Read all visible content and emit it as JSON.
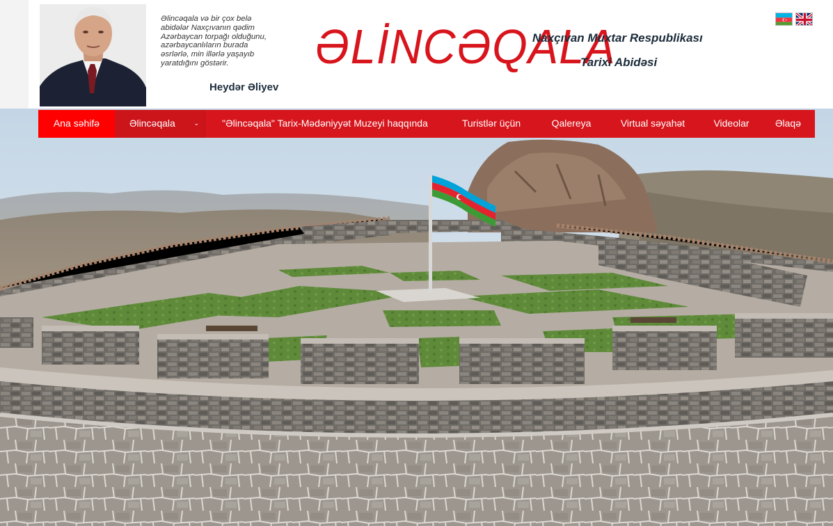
{
  "header": {
    "quote_lines": [
      "Əlincəqala və bir çox belə",
      "abidələr Naxçıvanın qədim",
      "Azərbaycan torpağı olduğunu,",
      "azərbaycanlıların burada",
      "əsrlərlə, min illərlə yaşayıb",
      "yaratdığını göstərir."
    ],
    "quote_author": "Heydər Əliyev",
    "logo": "ƏLİNCƏQALA",
    "subtitle_line1": "Naxçıvan Muxtar Respublikası",
    "subtitle_line2": "Tarixi Abidəsi"
  },
  "languages": [
    "az-flag-icon",
    "uk-flag-icon"
  ],
  "nav": {
    "items": [
      {
        "label": "Ana səhifə"
      },
      {
        "label": "Əlincəqala"
      },
      {
        "label": "\"Əlincəqala\" Tarix-Mədəniyyət Muzeyi haqqında"
      },
      {
        "label": "Turistlər üçün"
      },
      {
        "label": "Qalereya"
      },
      {
        "label": "Virtual səyahət"
      },
      {
        "label": "Videolar"
      },
      {
        "label": "Əlaqə"
      }
    ],
    "caret": "⌄"
  },
  "colors": {
    "accent": "#d7151d",
    "active": "#ff0000",
    "logo": "#d8141c",
    "text_dark": "#1b2b3a"
  },
  "hero": {
    "subject": "fortress panorama with azerbaijan flag"
  }
}
